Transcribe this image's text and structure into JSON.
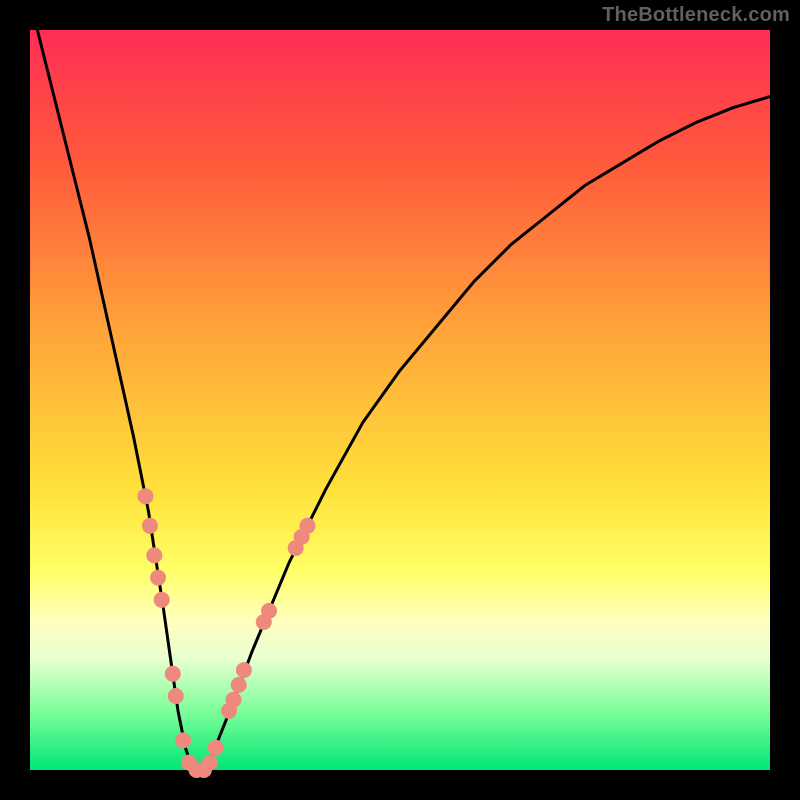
{
  "watermark": {
    "text": "TheBottleneck.com"
  },
  "plot": {
    "gradient_stops": [
      {
        "pct": 0,
        "color": "#ff2d55"
      },
      {
        "pct": 18,
        "color": "#ff5a3c"
      },
      {
        "pct": 40,
        "color": "#ffa23a"
      },
      {
        "pct": 62,
        "color": "#ffe13a"
      },
      {
        "pct": 73,
        "color": "#ffff66"
      },
      {
        "pct": 80,
        "color": "#ffffc0"
      },
      {
        "pct": 85,
        "color": "#e8ffd0"
      },
      {
        "pct": 92,
        "color": "#7dff9a"
      },
      {
        "pct": 100,
        "color": "#00e676"
      }
    ],
    "curve_color": "#000000",
    "curve_width": 3,
    "marker_color": "#ee8a7d",
    "marker_radius": 8
  },
  "chart_data": {
    "type": "line",
    "title": "",
    "xlabel": "",
    "ylabel": "",
    "xlim": [
      0,
      100
    ],
    "ylim": [
      0,
      100
    ],
    "series": [
      {
        "name": "bottleneck-curve",
        "x": [
          0,
          2,
          4,
          6,
          8,
          10,
          12,
          14,
          16,
          18,
          19,
          20,
          21,
          22,
          23,
          24,
          25,
          27,
          30,
          35,
          40,
          45,
          50,
          55,
          60,
          65,
          70,
          75,
          80,
          85,
          90,
          95,
          100
        ],
        "y": [
          104,
          96,
          88,
          80,
          72,
          63,
          54,
          45,
          35,
          22,
          15,
          8,
          3,
          0,
          0,
          0,
          3,
          8,
          16,
          28,
          38,
          47,
          54,
          60,
          66,
          71,
          75,
          79,
          82,
          85,
          87.5,
          89.5,
          91
        ]
      }
    ],
    "markers": [
      {
        "x": 15.6,
        "y": 37
      },
      {
        "x": 16.2,
        "y": 33
      },
      {
        "x": 16.8,
        "y": 29
      },
      {
        "x": 17.3,
        "y": 26
      },
      {
        "x": 17.8,
        "y": 23
      },
      {
        "x": 19.3,
        "y": 13
      },
      {
        "x": 19.7,
        "y": 10
      },
      {
        "x": 20.7,
        "y": 4
      },
      {
        "x": 21.5,
        "y": 1
      },
      {
        "x": 22.5,
        "y": 0
      },
      {
        "x": 23.5,
        "y": 0
      },
      {
        "x": 24.3,
        "y": 1
      },
      {
        "x": 25.1,
        "y": 3
      },
      {
        "x": 26.9,
        "y": 8
      },
      {
        "x": 27.5,
        "y": 9.5
      },
      {
        "x": 28.2,
        "y": 11.5
      },
      {
        "x": 28.9,
        "y": 13.5
      },
      {
        "x": 31.6,
        "y": 20
      },
      {
        "x": 32.3,
        "y": 21.5
      },
      {
        "x": 35.9,
        "y": 30
      },
      {
        "x": 36.7,
        "y": 31.5
      },
      {
        "x": 37.5,
        "y": 33
      }
    ]
  }
}
